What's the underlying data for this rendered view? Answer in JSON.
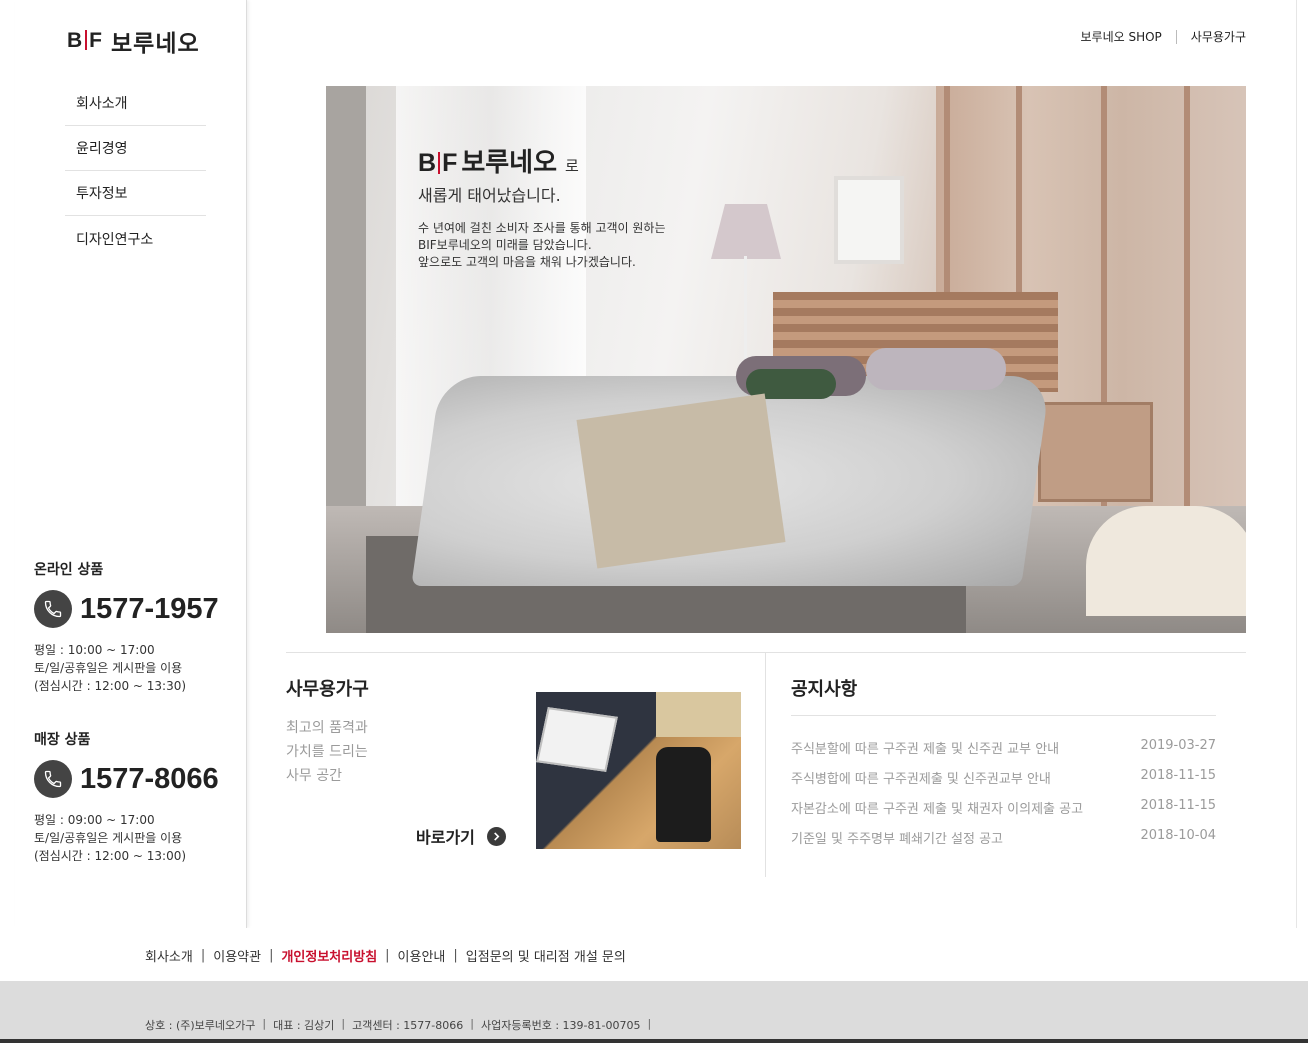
{
  "brand": {
    "mark": "BIF",
    "name": "보루네오"
  },
  "sidebar": {
    "nav": [
      {
        "label": "회사소개"
      },
      {
        "label": "윤리경영"
      },
      {
        "label": "투자정보"
      },
      {
        "label": "디자인연구소"
      }
    ],
    "contacts": [
      {
        "title": "온라인 상품",
        "phone": "1577-1957",
        "hours": [
          "평일 : 10:00 ~ 17:00",
          "토/일/공휴일은 게시판을 이용",
          "(점심시간 : 12:00 ~ 13:30)"
        ]
      },
      {
        "title": "매장 상품",
        "phone": "1577-8066",
        "hours": [
          "평일 : 09:00 ~ 17:00",
          "토/일/공휴일은 게시판을 이용",
          "(점심시간 : 12:00 ~ 13:00)"
        ]
      }
    ]
  },
  "toplinks": [
    "보루네오 SHOP",
    "사무용가구"
  ],
  "hero": {
    "brand_suffix": "로",
    "subtitle": "새롭게 태어났습니다.",
    "description": [
      "수 년여에 걸친 소비자 조사를 통해 고객이 원하는",
      "BIF보루네오의 미래를 담았습니다.",
      "앞으로도 고객의 마음을 채워 나가겠습니다."
    ]
  },
  "office": {
    "title": "사무용가구",
    "description": [
      "최고의 품격과",
      "가치를 드리는",
      "사무 공간"
    ],
    "goto_label": "바로가기"
  },
  "notice": {
    "title": "공지사항",
    "items": [
      {
        "title": "주식분할에 따른 구주권 제출 및 신주권 교부 안내",
        "date": "2019-03-27"
      },
      {
        "title": "주식병합에 따른 구주권제출 및 신주권교부 안내",
        "date": "2018-11-15"
      },
      {
        "title": "자본감소에 따른 구주권 제출 및 채권자 이의제출 공고",
        "date": "2018-11-15"
      },
      {
        "title": "기준일 및 주주명부 폐쇄기간 설정 공고",
        "date": "2018-10-04"
      }
    ]
  },
  "footer": {
    "links": [
      "회사소개",
      "이용약관",
      "개인정보처리방침",
      "이용안내",
      "입점문의 및 대리점 개설 문의"
    ],
    "info": [
      "상호 : (주)보루네오가구",
      "대표 : 김상기",
      "고객센터 : 1577-8066",
      "사업자등록번호 : 139-81-00705"
    ]
  },
  "colors": {
    "accent": "#c8102e",
    "text": "#222222",
    "muted": "#9b9b9b",
    "footer_bg": "#dcdcdc"
  },
  "icons": {
    "phone": "phone-icon",
    "goto": "chevron-right-icon"
  }
}
